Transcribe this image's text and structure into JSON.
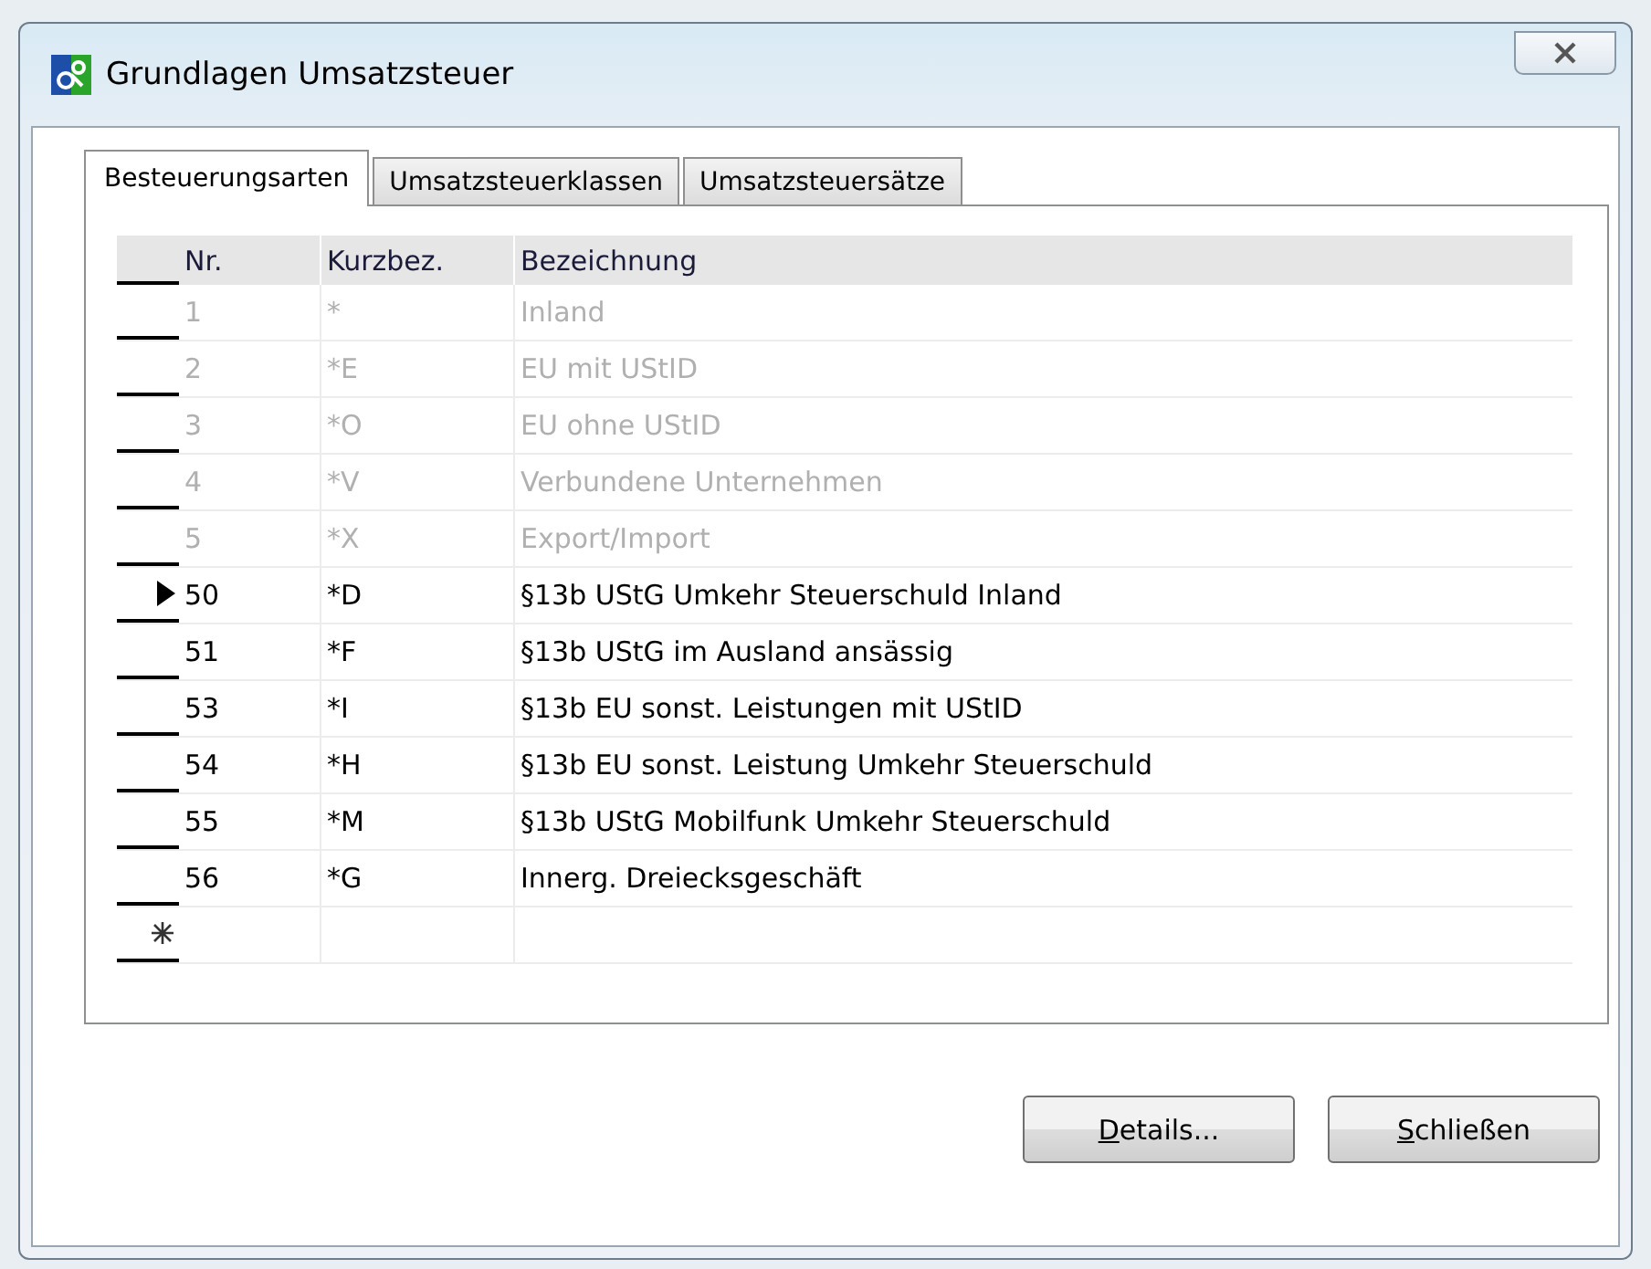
{
  "window": {
    "title": "Grundlagen Umsatzsteuer"
  },
  "tabs": [
    {
      "label": "Besteuerungsarten",
      "selected": true
    },
    {
      "label": "Umsatzsteuerklassen",
      "selected": false
    },
    {
      "label": "Umsatzsteuersätze",
      "selected": false
    }
  ],
  "table": {
    "columns": [
      "Nr.",
      "Kurzbez.",
      "Bezeichnung"
    ],
    "rows": [
      {
        "cells": [
          "1",
          "*",
          "Inland"
        ],
        "disabled": true,
        "selected": false
      },
      {
        "cells": [
          "2",
          "*E",
          "EU mit UStID"
        ],
        "disabled": true,
        "selected": false
      },
      {
        "cells": [
          "3",
          "*O",
          "EU ohne UStID"
        ],
        "disabled": true,
        "selected": false
      },
      {
        "cells": [
          "4",
          "*V",
          "Verbundene Unternehmen"
        ],
        "disabled": true,
        "selected": false
      },
      {
        "cells": [
          "5",
          "*X",
          "Export/Import"
        ],
        "disabled": true,
        "selected": false
      },
      {
        "cells": [
          "50",
          "*D",
          "§13b UStG Umkehr Steuerschuld Inland"
        ],
        "disabled": false,
        "selected": true
      },
      {
        "cells": [
          "51",
          "*F",
          "§13b UStG im Ausland ansässig"
        ],
        "disabled": false,
        "selected": false
      },
      {
        "cells": [
          "53",
          "*I",
          "§13b EU sonst. Leistungen mit UStID"
        ],
        "disabled": false,
        "selected": false
      },
      {
        "cells": [
          "54",
          "*H",
          "§13b EU sonst. Leistung Umkehr Steuerschuld"
        ],
        "disabled": false,
        "selected": false
      },
      {
        "cells": [
          "55",
          "*M",
          "§13b UStG Mobilfunk Umkehr Steuerschuld"
        ],
        "disabled": false,
        "selected": false
      },
      {
        "cells": [
          "56",
          "*G",
          "Innerg. Dreiecksgeschäft"
        ],
        "disabled": false,
        "selected": false
      }
    ],
    "new_row": true
  },
  "buttons": [
    "Details...",
    "Schließen"
  ]
}
